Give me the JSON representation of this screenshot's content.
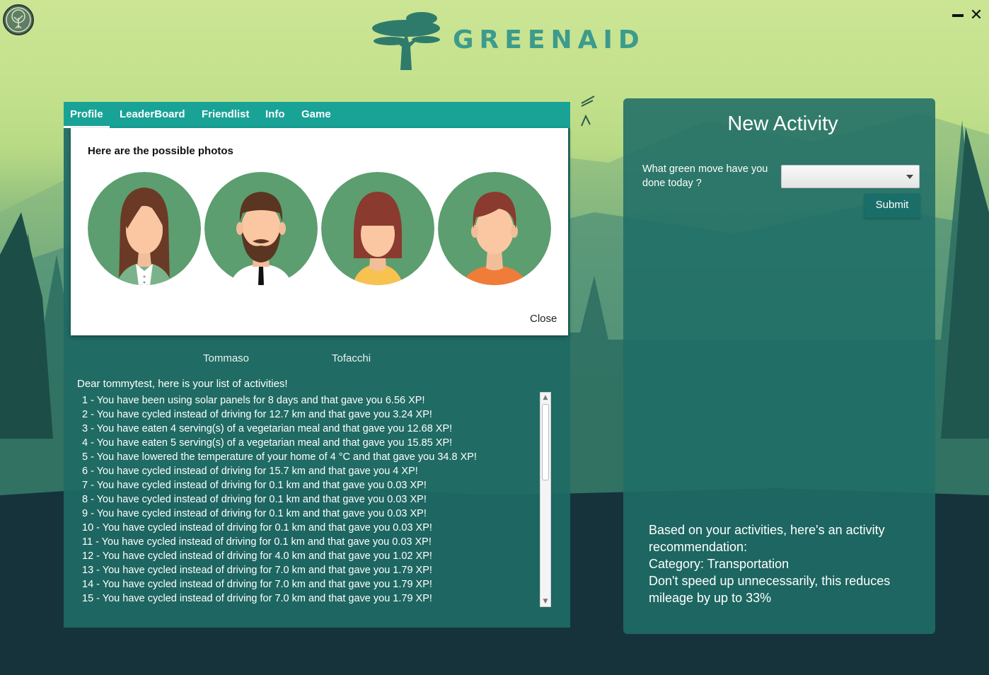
{
  "window": {
    "app_icon": "tree-icon",
    "minimize_icon": "minimize-icon",
    "close_symbol": "✕"
  },
  "logo": {
    "text": "GREENAID",
    "icon": "acacia-tree-icon"
  },
  "tabs": [
    {
      "label": "Profile",
      "active": true
    },
    {
      "label": "LeaderBoard",
      "active": false
    },
    {
      "label": "Friendlist",
      "active": false
    },
    {
      "label": "Info",
      "active": false
    },
    {
      "label": "Game",
      "active": false
    }
  ],
  "photo_dialog": {
    "title": "Here are the possible photos",
    "avatars": [
      "woman-long-hair-avatar",
      "bearded-man-avatar",
      "woman-bob-avatar",
      "young-man-avatar"
    ],
    "close_label": "Close"
  },
  "profile": {
    "first_name": "Tommaso",
    "last_name": "Tofacchi"
  },
  "activities": {
    "greeting": "Dear tommytest, here is your list of activities!",
    "items": [
      "1 - You have been using solar panels for 8 days and that gave you 6.56 XP!",
      "2 - You have cycled instead of driving for 12.7 km and that gave you 3.24 XP!",
      "3 - You have eaten 4 serving(s) of a vegetarian meal and that gave you 12.68 XP!",
      "4 - You have eaten 5 serving(s) of a vegetarian meal and that gave you 15.85 XP!",
      "5 - You have lowered the temperature of your home of 4 °C and that gave you 34.8 XP!",
      "6 - You have cycled instead of driving for 15.7 km and that gave you 4 XP!",
      "7 - You have cycled instead of driving for 0.1 km and that gave you 0.03 XP!",
      "8 - You have cycled instead of driving for 0.1 km and that gave you 0.03 XP!",
      "9 - You have cycled instead of driving for 0.1 km and that gave you 0.03 XP!",
      "10 - You have cycled instead of driving for 0.1 km and that gave you 0.03 XP!",
      "11 - You have cycled instead of driving for 0.1 km and that gave you 0.03 XP!",
      "12 - You have cycled instead of driving for 4.0 km and that gave you 1.02 XP!",
      "13 - You have cycled instead of driving for 7.0 km and that gave you 1.79 XP!",
      "14 - You have cycled instead of driving for 7.0 km and that gave you 1.79 XP!",
      "15 - You have cycled instead of driving for 7.0 km and that gave you 1.79 XP!"
    ]
  },
  "new_activity": {
    "title": "New Activity",
    "question": "What green move have you done today ?",
    "selected_value": "",
    "submit_label": "Submit"
  },
  "recommendation": {
    "intro": "Based on your activities, here's an activity recommendation:",
    "category": "Category: Transportation",
    "tip": "Don't speed up unnecessarily, this reduces mileage by up to 33%"
  },
  "colors": {
    "tab_bar": "#18a396",
    "panel": "#1f6b64",
    "logo_text": "#3c9b8c",
    "avatar_bg": "#5c9e6f"
  }
}
